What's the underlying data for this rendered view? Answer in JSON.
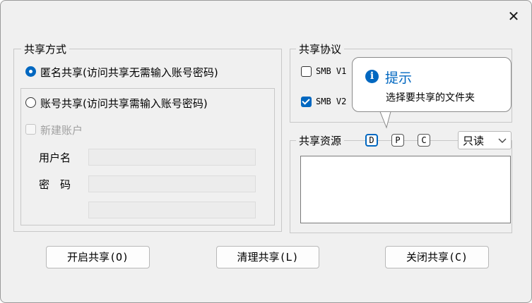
{
  "window": {
    "close_glyph": "✕"
  },
  "share_mode": {
    "legend": "共享方式",
    "anonymous_label": "匿名共享(访问共享无需输入账号密码)",
    "account_label": "账号共享(访问共享需输入账号密码)",
    "new_account_label": "新建账户",
    "username_label": "用户名",
    "password_label": "密　码",
    "selected": "anonymous"
  },
  "protocol": {
    "legend": "共享协议",
    "smb_v1_label": "SMB V1",
    "smb_v1_checked": false,
    "smb_v2_label": "SMB V2",
    "smb_v2_checked": true
  },
  "tooltip": {
    "title": "提示",
    "message": "选择要共享的文件夹",
    "icon": "info-icon"
  },
  "resources": {
    "legend": "共享资源",
    "drives": [
      "D",
      "P",
      "C"
    ],
    "selected_drive": "D",
    "access_selected": "只读",
    "items": []
  },
  "buttons": {
    "start": "开启共享(O)",
    "clear": "清理共享(L)",
    "stop": "关闭共享(C)"
  },
  "colors": {
    "accent": "#0067c0",
    "dialog_bg": "#f0f0f0"
  }
}
